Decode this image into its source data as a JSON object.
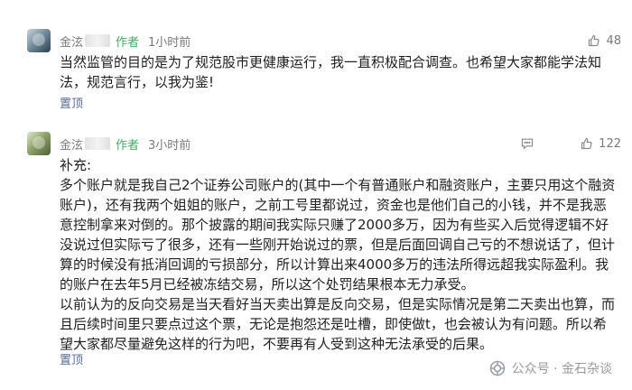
{
  "comments": [
    {
      "nickname": "金泫",
      "author_badge": "作者",
      "time": "1小时前",
      "likes": "48",
      "text": "当然监管的目的是为了规范股市更健康运行，我一直积极配合调查。也希望大家都能学法知法，规范言行，以我为鉴!",
      "pin": "置顶"
    },
    {
      "nickname": "金泫",
      "author_badge": "作者",
      "time": "3小时前",
      "likes": "122",
      "text": "补充:\n多个账户就是我自己2个证券公司账户的(其中一个有普通账户和融资账户，主要只用这个融资账户)，还有我两个姐姐的账户，之前工号里都说过，资金也是他们自己的小钱，并不是我恶意控制拿来对倒的。那个披露的期间我实际只赚了2000多万，因为有些买入后觉得逻辑不好没说过但实际亏了很多，还有一些刚开始说过的票，但是后面回调自己亏的不想说话了，但计算的时候没有抵消回调的亏损部分，所以计算出来4000多万的违法所得远超我实际盈利。我的账户在去年5月已经被冻结交易，所以这个处罚结果根本无力承受。\n以前认为的反向交易是当天看好当天卖出算是反向交易，但是实际情况是第二天卖出也算，而且后续时间里只要点过这个票，无论是抱怨还是吐槽，即使做t，也会被认为有问题。所以希望大家都尽量避免这样的行为吧，不要再有人受到这种无法承受的后果。",
      "pin": "置顶"
    }
  ],
  "watermark": "公众号 · 金石杂谈",
  "colors": {
    "author": "#45a865",
    "link": "#576b95",
    "meta": "#7a7a7a"
  },
  "icons": [
    "avatar",
    "reply-icon",
    "like-icon",
    "wechat-official-account-icon"
  ]
}
